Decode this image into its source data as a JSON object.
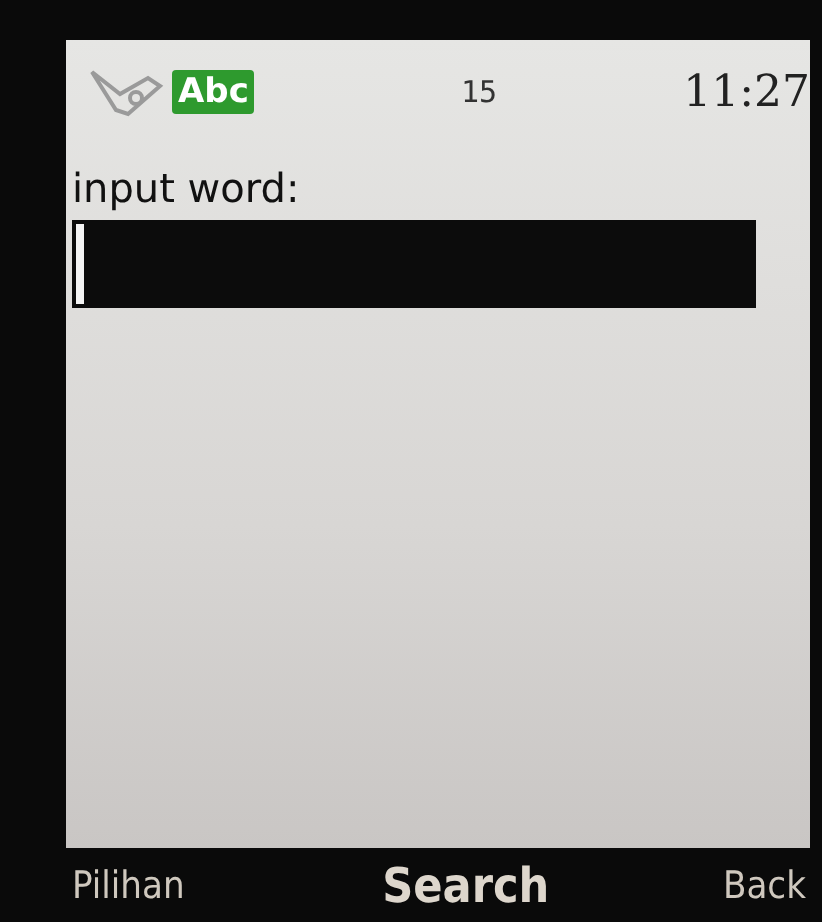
{
  "status_bar": {
    "input_mode": "Abc",
    "char_count": "15",
    "time": "11:27"
  },
  "prompt": {
    "label": "input word:"
  },
  "softkeys": {
    "left": "Pilihan",
    "center": "Search",
    "right": "Back"
  }
}
